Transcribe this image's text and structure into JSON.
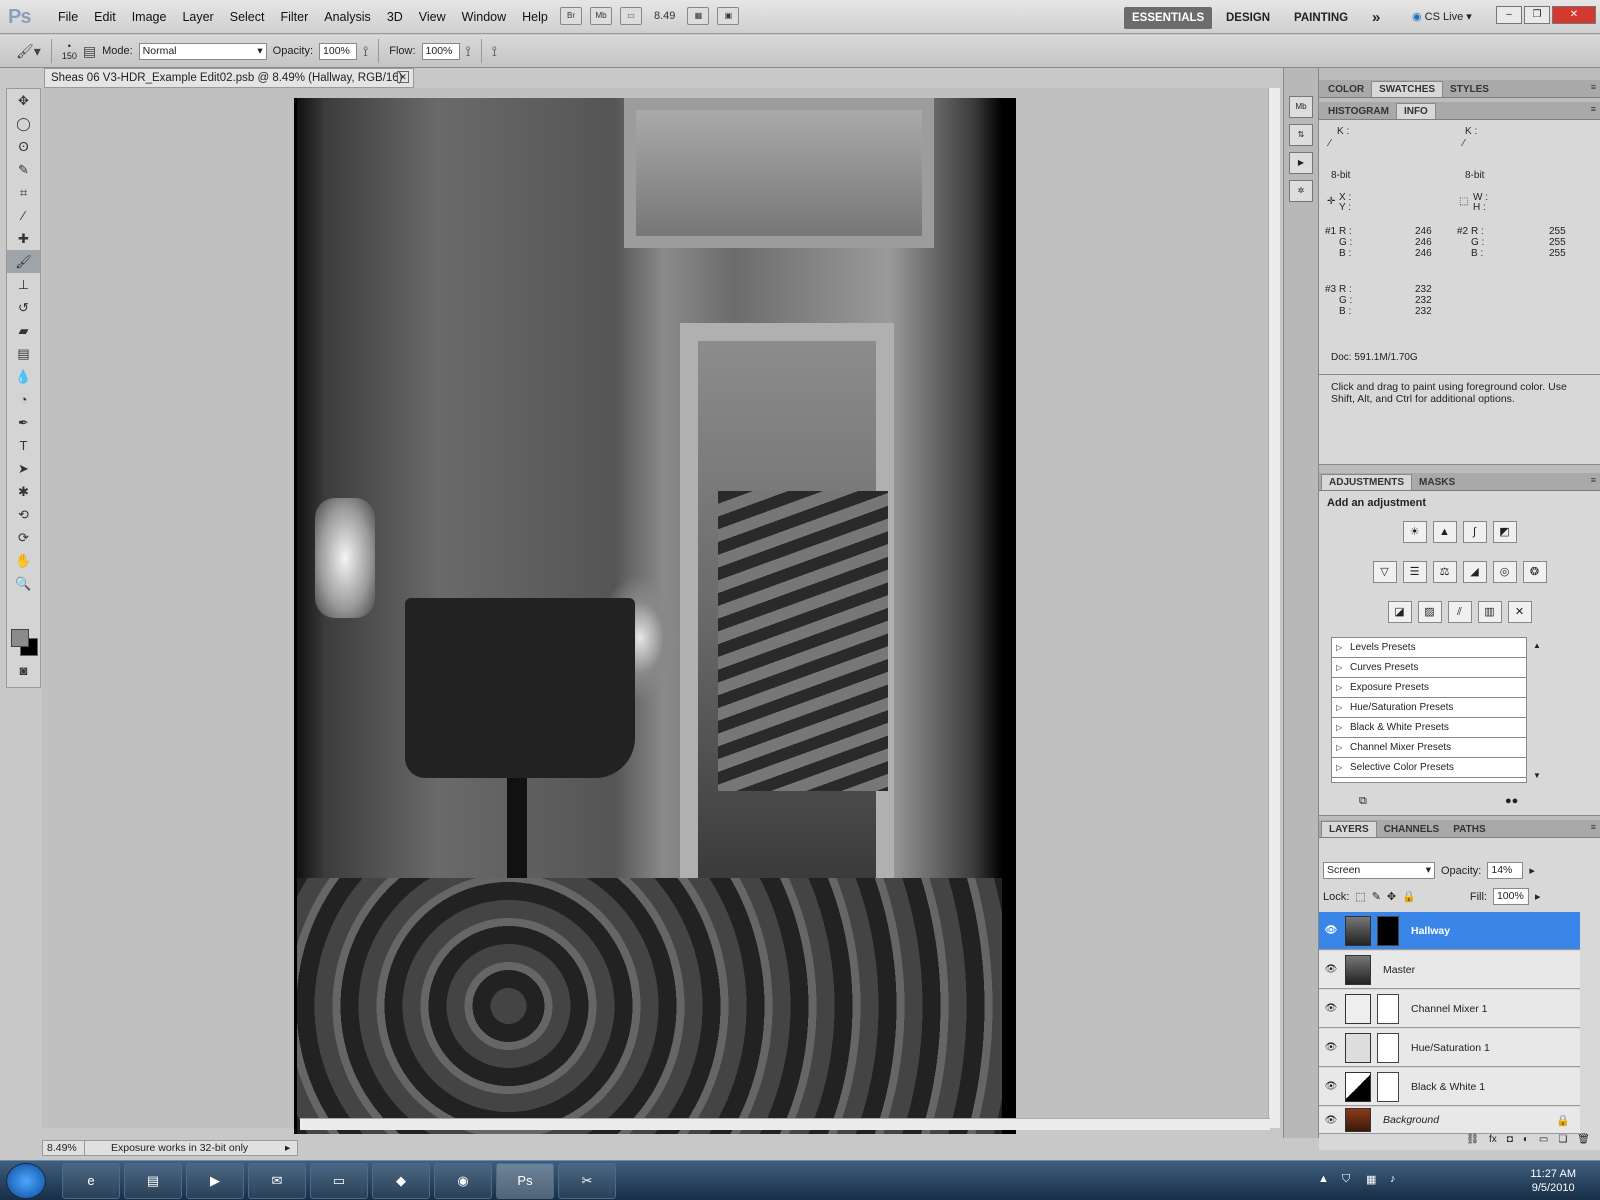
{
  "app": {
    "logo": "Ps",
    "menu": [
      "File",
      "Edit",
      "Image",
      "Layer",
      "Select",
      "Filter",
      "Analysis",
      "3D",
      "View",
      "Window",
      "Help"
    ],
    "bridge": "Br",
    "minibridge": "Mb",
    "zoom": "8.49",
    "workspaces": [
      "ESSENTIALS",
      "DESIGN",
      "PAINTING"
    ],
    "more": "»",
    "cslive": "CS Live"
  },
  "options": {
    "brush_size": "150",
    "mode_label": "Mode:",
    "mode_value": "Normal",
    "opacity_label": "Opacity:",
    "opacity_value": "100%",
    "flow_label": "Flow:",
    "flow_value": "100%"
  },
  "document": {
    "tab_title": "Sheas 06 V3-HDR_Example Edit02.psb @ 8.49% (Hallway, RGB/16)",
    "status_zoom": "8.49%",
    "status_text": "Exposure works in 32-bit only"
  },
  "panels": {
    "top_tabs": [
      "COLOR",
      "SWATCHES",
      "STYLES"
    ],
    "info_tabs": [
      "HISTOGRAM",
      "INFO"
    ],
    "info": {
      "k1": "K :",
      "k2": "K :",
      "bit1": "8-bit",
      "bit2": "8-bit",
      "x": "X :",
      "y": "Y :",
      "w": "W :",
      "h": "H :",
      "s1": {
        "label": "#1",
        "r": "246",
        "g": "246",
        "b": "246"
      },
      "s2": {
        "label": "#2",
        "r": "255",
        "g": "255",
        "b": "255"
      },
      "s3": {
        "label": "#3",
        "r": "232",
        "g": "232",
        "b": "232"
      },
      "r": "R :",
      "g": "G :",
      "b": "B :",
      "doc": "Doc: 591.1M/1.70G",
      "hint": "Click and drag to paint using foreground color.  Use Shift, Alt, and Ctrl for additional options."
    },
    "adj_tabs": [
      "ADJUSTMENTS",
      "MASKS"
    ],
    "adj_title": "Add an adjustment",
    "presets": [
      "Levels Presets",
      "Curves Presets",
      "Exposure Presets",
      "Hue/Saturation Presets",
      "Black & White Presets",
      "Channel Mixer Presets",
      "Selective Color Presets"
    ],
    "layers_tabs": [
      "LAYERS",
      "CHANNELS",
      "PATHS"
    ],
    "blend": "Screen",
    "opacity_label": "Opacity:",
    "opacity": "14%",
    "lock_label": "Lock:",
    "fill_label": "Fill:",
    "fill": "100%",
    "layers": [
      "Hallway",
      "Master",
      "Channel Mixer 1",
      "Hue/Saturation 1",
      "Black & White 1",
      "Background"
    ]
  },
  "taskbar": {
    "time": "11:27 AM",
    "date": "9/5/2010"
  }
}
